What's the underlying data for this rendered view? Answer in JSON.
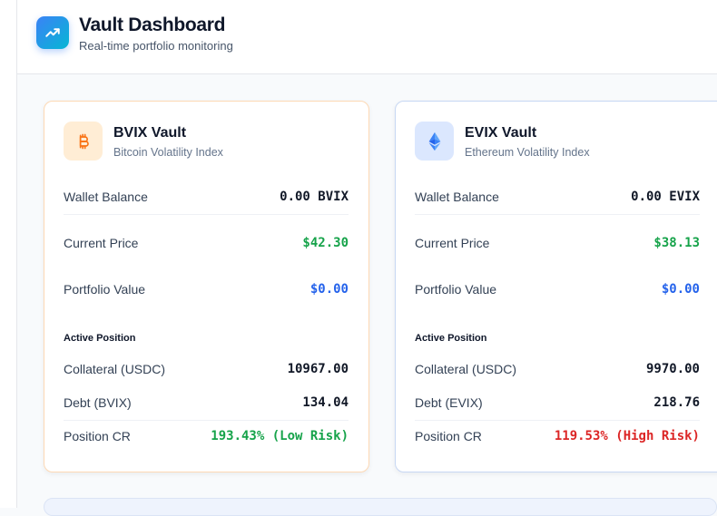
{
  "header": {
    "title": "Vault Dashboard",
    "subtitle": "Real-time portfolio monitoring",
    "logo_icon": "trending-up-icon"
  },
  "vaults": [
    {
      "id": "bvix",
      "icon": "bitcoin-icon",
      "accent": "#f97316",
      "title": "BVIX Vault",
      "subtitle": "Bitcoin Volatility Index",
      "wallet_balance_label": "Wallet Balance",
      "wallet_balance": "0.00 BVIX",
      "current_price_label": "Current Price",
      "current_price": "$42.30",
      "portfolio_value_label": "Portfolio Value",
      "portfolio_value": "$0.00",
      "position_header": "Active Position",
      "collateral_label": "Collateral (USDC)",
      "collateral": "10967.00",
      "debt_label": "Debt (BVIX)",
      "debt": "134.04",
      "cr_label": "Position CR",
      "cr": "193.43% (Low Risk)",
      "cr_status_color": "#16a34a"
    },
    {
      "id": "evix",
      "icon": "ethereum-icon",
      "accent": "#3b82f6",
      "title": "EVIX Vault",
      "subtitle": "Ethereum Volatility Index",
      "wallet_balance_label": "Wallet Balance",
      "wallet_balance": "0.00 EVIX",
      "current_price_label": "Current Price",
      "current_price": "$38.13",
      "portfolio_value_label": "Portfolio Value",
      "portfolio_value": "$0.00",
      "position_header": "Active Position",
      "collateral_label": "Collateral (USDC)",
      "collateral": "9970.00",
      "debt_label": "Debt (EVIX)",
      "debt": "218.76",
      "cr_label": "Position CR",
      "cr": "119.53% (High Risk)",
      "cr_status_color": "#dc2626"
    }
  ]
}
